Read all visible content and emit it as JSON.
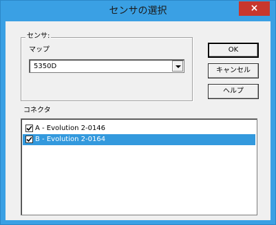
{
  "window": {
    "title": "センサの選択",
    "close_label": "×",
    "titlebar_color": "#3aa0e4",
    "close_color": "#c8372d"
  },
  "sensor_group": {
    "legend": "センサ:",
    "map_label": "マップ",
    "map_select": {
      "value": "5350D"
    }
  },
  "buttons": {
    "ok": "OK",
    "cancel": "キャンセル",
    "help": "ヘルプ"
  },
  "connector": {
    "label": "コネクタ",
    "items": [
      {
        "label": "A - Evolution 2-0146",
        "checked": true,
        "selected": false
      },
      {
        "label": "B - Evolution 2-0164",
        "checked": true,
        "selected": true
      }
    ],
    "selection_color": "#3399dd"
  }
}
